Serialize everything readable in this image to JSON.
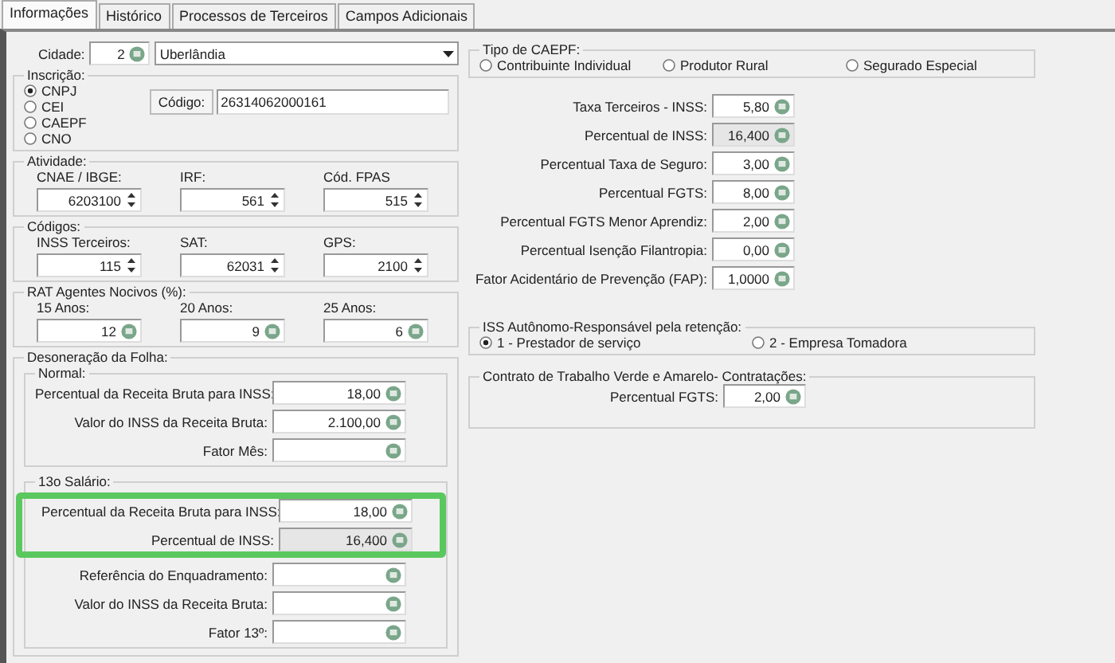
{
  "tabs": [
    {
      "label": "Informações",
      "selected": true
    },
    {
      "label": "Histórico",
      "selected": false
    },
    {
      "label": "Processos de Terceiros",
      "selected": false
    },
    {
      "label": "Campos Adicionais",
      "selected": false
    }
  ],
  "cidade": {
    "label": "Cidade:",
    "code": "2",
    "name": "Uberlândia"
  },
  "inscricao": {
    "title": "Inscrição:",
    "options": [
      {
        "label": "CNPJ",
        "selected": true
      },
      {
        "label": "CEI",
        "selected": false
      },
      {
        "label": "CAEPF",
        "selected": false
      },
      {
        "label": "CNO",
        "selected": false
      }
    ],
    "codigo_label": "Código:",
    "codigo_value": "26314062000161"
  },
  "groups": [
    {
      "title": "Atividade:",
      "fields": [
        {
          "label": "CNAE / IBGE:",
          "value": "6203100",
          "kind": "spin"
        },
        {
          "label": "IRF:",
          "value": "561",
          "kind": "spin"
        },
        {
          "label": "Cód. FPAS",
          "value": "515",
          "kind": "spin"
        }
      ]
    },
    {
      "title": "Códigos:",
      "fields": [
        {
          "label": "INSS Terceiros:",
          "value": "115",
          "kind": "spin"
        },
        {
          "label": "SAT:",
          "value": "62031",
          "kind": "spin"
        },
        {
          "label": "GPS:",
          "value": "2100",
          "kind": "spin"
        }
      ]
    },
    {
      "title": "RAT Agentes Nocivos (%):",
      "fields": [
        {
          "label": "15 Anos:",
          "value": "12",
          "kind": "calc"
        },
        {
          "label": "20 Anos:",
          "value": "9",
          "kind": "calc"
        },
        {
          "label": "25 Anos:",
          "value": "6",
          "kind": "calc"
        }
      ]
    }
  ],
  "desoneracao": {
    "title": "Desoneração da Folha:",
    "sections": [
      {
        "title": "Normal:",
        "rows": [
          {
            "label": "Percentual da Receita Bruta para INSS:",
            "value": "18,00",
            "readonly": false,
            "highlighted": false
          },
          {
            "label": "Valor do INSS da Receita Bruta:",
            "value": "2.100,00",
            "readonly": false,
            "highlighted": false
          },
          {
            "label": "Fator Mês:",
            "readonly": false,
            "highlighted": false
          }
        ]
      },
      {
        "title": "13o Salário:",
        "rows": [
          {
            "label": "Percentual da Receita Bruta para INSS:",
            "value": "18,00",
            "readonly": false,
            "highlighted": true
          },
          {
            "label": "Percentual de INSS:",
            "value": "16,400",
            "readonly": true,
            "highlighted": true
          },
          {
            "label": "Referência do Enquadramento:",
            "readonly": false,
            "highlighted": false
          },
          {
            "label": "Valor do INSS da Receita Bruta:",
            "readonly": false,
            "highlighted": false
          },
          {
            "label": "Fator 13º:",
            "readonly": false,
            "highlighted": false
          }
        ]
      }
    ]
  },
  "caepf": {
    "title": "Tipo de CAEPF:",
    "options": [
      {
        "label": "Contribuinte Individual",
        "selected": false
      },
      {
        "label": "Produtor Rural",
        "selected": false
      },
      {
        "label": "Segurado Especial",
        "selected": false
      }
    ]
  },
  "rates": [
    {
      "label": "Taxa Terceiros - INSS:",
      "value": "5,80",
      "readonly": false
    },
    {
      "label": "Percentual de INSS:",
      "value": "16,400",
      "readonly": true
    },
    {
      "label": "Percentual Taxa de Seguro:",
      "value": "3,00",
      "readonly": false
    },
    {
      "label": "Percentual FGTS:",
      "value": "8,00",
      "readonly": false
    },
    {
      "label": "Percentual FGTS Menor Aprendiz:",
      "value": "2,00",
      "readonly": false
    },
    {
      "label": "Percentual Isenção Filantropia:",
      "value": "0,00",
      "readonly": false
    },
    {
      "label": "Fator Acidentário de Prevenção (FAP):",
      "value": "1,0000",
      "readonly": false
    }
  ],
  "iss": {
    "title": "ISS Autônomo-Responsável pela retenção:",
    "options": [
      {
        "label": "1 - Prestador de serviço",
        "selected": true
      },
      {
        "label": "2 - Empresa Tomadora",
        "selected": false
      }
    ]
  },
  "contrato": {
    "title": "Contrato de Trabalho Verde e Amarelo- Contratações:",
    "rows": [
      {
        "label": "Percentual FGTS:",
        "value": "2,00",
        "readonly": false
      }
    ]
  }
}
